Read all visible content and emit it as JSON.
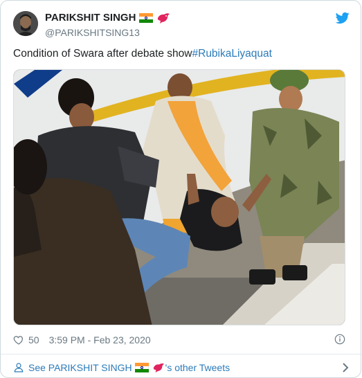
{
  "tweet": {
    "display_name": "PARIKSHIT SINGH",
    "handle": "@PARIKSHITSING13",
    "text": "Condition of Swara after debate show",
    "hashtag": "#RubikaLiyaquat",
    "likes": "50",
    "timestamp": "3:59 PM - Feb 23, 2020"
  },
  "footer": {
    "prefix": "See PARIKSHIT SINGH",
    "suffix": "'s other Tweets"
  },
  "icons": {
    "brand": "twitter-bird-icon",
    "flag": "india-flag-icon",
    "emoji": "red-bird-icon",
    "like": "heart-icon",
    "info": "info-icon",
    "person": "person-icon",
    "chevron": "chevron-right-icon"
  },
  "colors": {
    "link": "#2b7bb9",
    "twitter_blue": "#1da1f2",
    "muted": "#697882",
    "border": "#cfd9de"
  }
}
